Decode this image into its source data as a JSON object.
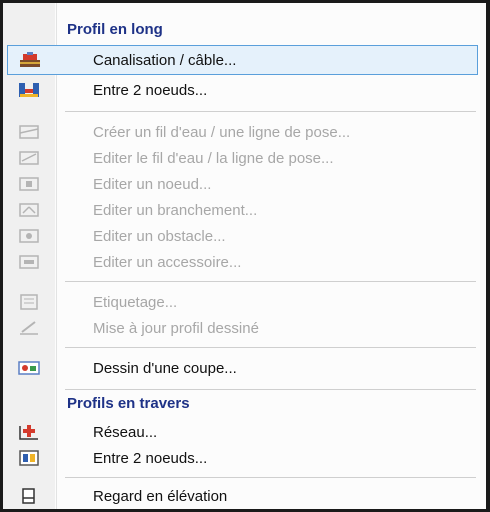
{
  "menu": {
    "section1": {
      "title": "Profil en long"
    },
    "items1": [
      {
        "label": "Canalisation / câble...",
        "icon": "pipe-profile-icon"
      },
      {
        "label": "Entre 2 noeuds...",
        "icon": "nodes-profile-icon"
      }
    ],
    "items2": [
      {
        "label": "Créer un fil d'eau / une ligne de pose...",
        "icon": "create-line-icon"
      },
      {
        "label": "Editer le fil d'eau / la ligne de pose...",
        "icon": "edit-line-icon"
      },
      {
        "label": "Editer un noeud...",
        "icon": "edit-node-icon"
      },
      {
        "label": "Editer un branchement...",
        "icon": "edit-branch-icon"
      },
      {
        "label": "Editer un obstacle...",
        "icon": "edit-obstacle-icon"
      },
      {
        "label": "Editer un accessoire...",
        "icon": "edit-accessory-icon"
      }
    ],
    "items3": [
      {
        "label": "Etiquetage...",
        "icon": "label-icon"
      },
      {
        "label": "Mise à jour profil dessiné",
        "icon": "update-profile-icon"
      }
    ],
    "items4": [
      {
        "label": "Dessin d'une coupe...",
        "icon": "section-drawing-icon"
      }
    ],
    "section2": {
      "title": "Profils en travers"
    },
    "items5": [
      {
        "label": "Réseau...",
        "icon": "network-cross-icon"
      },
      {
        "label": "Entre 2 noeuds...",
        "icon": "nodes-cross-icon"
      }
    ],
    "items6": [
      {
        "label": "Regard en élévation",
        "icon": "manhole-elevation-icon"
      }
    ],
    "colors": {
      "header": "#1e3287",
      "highlight_bg": "#e5f1fb",
      "highlight_border": "#5a9fdb",
      "disabled_text": "#a7a7a7"
    }
  }
}
